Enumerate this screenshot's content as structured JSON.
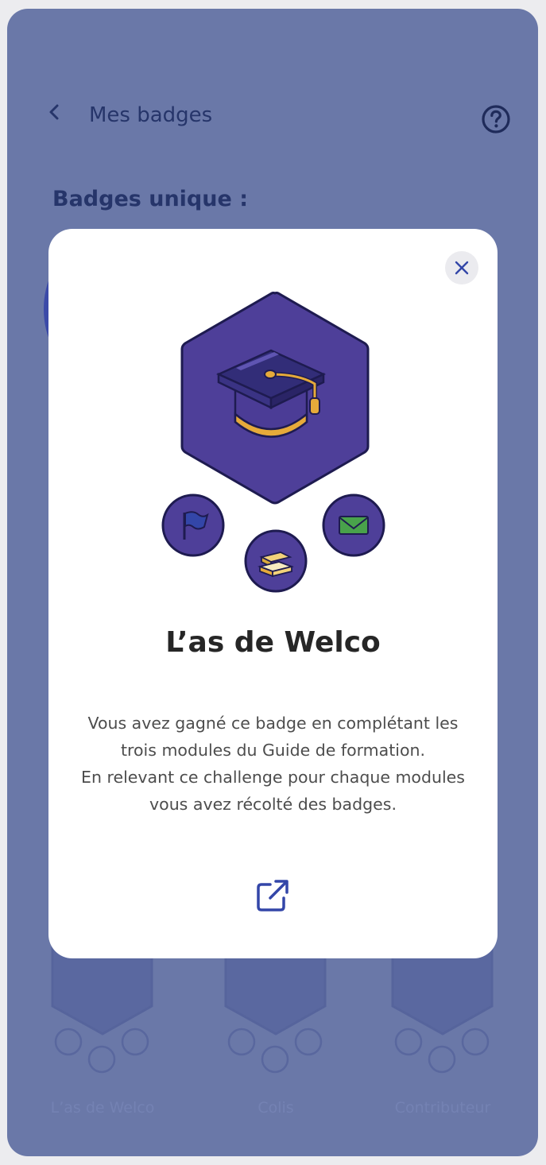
{
  "header": {
    "title": "Mes badges",
    "back_icon": "chevron-left-icon",
    "help_icon": "question-circle-icon"
  },
  "section": {
    "title": "Badges unique :"
  },
  "background_badges": [
    {
      "label": "L’as de Welco"
    },
    {
      "label": "Colis"
    },
    {
      "label": "Contributeur"
    }
  ],
  "modal": {
    "title": "L’as de Welco",
    "description_lines": [
      "Vous avez gagné ce badge en complétant les",
      "trois modules du Guide de formation.",
      "En relevant ce challenge pour chaque modules",
      "vous avez récolté des badges."
    ],
    "close_icon": "close-icon",
    "open_icon": "external-link-icon",
    "badge_icon": "graduation-cap-icon",
    "sub_badges": [
      "flag-icon",
      "books-icon",
      "envelope-icon"
    ]
  },
  "colors": {
    "backdrop": "#6a78a8",
    "badge_purple": "#4e3f99",
    "accent_gold": "#e6aa3a",
    "title_navy": "#26356a",
    "link_blue": "#3346a8"
  }
}
